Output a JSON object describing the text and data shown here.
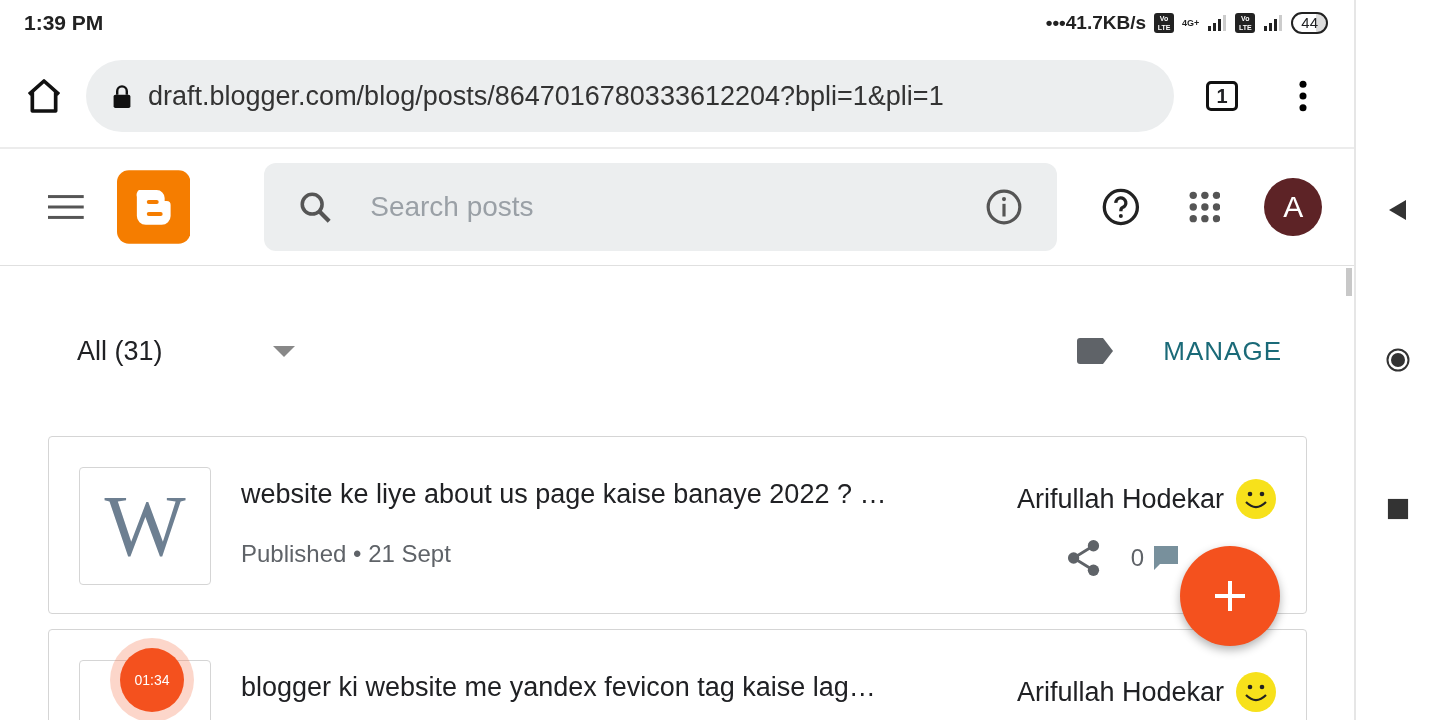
{
  "status_bar": {
    "time": "1:39 PM",
    "network_speed": "•••41.7KB/s",
    "sim_badges": [
      "Vo LTE",
      "Vo LTE"
    ],
    "network_type": "4G+",
    "battery": "44"
  },
  "browser": {
    "url": "draft.blogger.com/blog/posts/8647016780333612204?bpli=1&pli=1",
    "tab_count": "1"
  },
  "header": {
    "search": {
      "placeholder": "Search posts"
    },
    "avatar_letter": "A"
  },
  "filter": {
    "label": "All (31)",
    "manage": "MANAGE"
  },
  "posts": [
    {
      "thumbnail_letter": "W",
      "title": "website ke liye about us page kaise banaye 2022 ? …",
      "status": "Published • 21 Sept",
      "author": "Arifullah Hodekar",
      "comments": "0"
    },
    {
      "title": "blogger ki website me yandex fevicon tag kaise lag…",
      "author": "Arifullah Hodekar"
    }
  ],
  "recorder": {
    "elapsed": "01:34"
  }
}
